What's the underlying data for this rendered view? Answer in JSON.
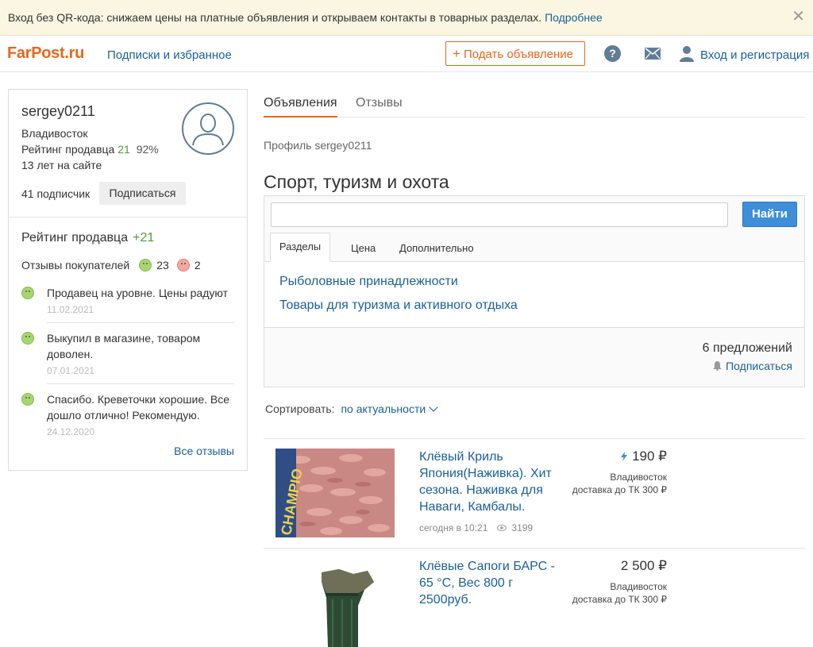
{
  "banner": {
    "text": "Вход без QR-кода: снижаем цены на платные объявления и открываем контакты в товарных разделах.",
    "more": "Подробнее",
    "close": "✕"
  },
  "header": {
    "logo_main": "FarPost",
    "logo_ru": ".ru",
    "subs": "Подписки и избранное",
    "post_plus": "+",
    "post": "Подать объявление",
    "help": "?",
    "login": "Вход и регистрация"
  },
  "profile": {
    "name": "sergey0211",
    "city": "Владивосток",
    "rating_label": "Рейтинг продавца",
    "rating_value": "21",
    "rating_pct": "92%",
    "years": "13 лет на сайте",
    "subscribers": "41 подписчик",
    "subscribe_btn": "Подписаться",
    "rating_title": "Рейтинг продавца",
    "rating_title_value": "+21",
    "reviews_label": "Отзывы покупателей",
    "good_count": "23",
    "bad_count": "2",
    "reviews": [
      {
        "text": "Продавец на уровне. Цены радуют",
        "date": "11.02.2021"
      },
      {
        "text": "Выкупил в магазине, товаром доволен.",
        "date": "07.01.2021"
      },
      {
        "text": "Спасибо. Креветочки хорошие. Все дошло отлично! Рекомендую.",
        "date": "24.12.2020"
      }
    ],
    "all_reviews": "Все отзывы"
  },
  "tabs": {
    "ads": "Объявления",
    "reviews": "Отзывы"
  },
  "crumb": "Профиль sergey0211",
  "category_title": "Спорт, туризм и охота",
  "search": {
    "value": "",
    "button": "Найти",
    "tabs": [
      "Разделы",
      "Цена",
      "Дополнительно"
    ],
    "sections": [
      "Рыболовные принадлежности",
      "Товары для туризма и активного отдыха"
    ],
    "offers": "6 предложений",
    "subscribe": "Подписаться"
  },
  "sort": {
    "label": "Сортировать:",
    "value": "по актуальности"
  },
  "items": [
    {
      "title": "Клёвый Криль Япония(Наживка). Хит сезона. Наживка для Наваги, Камбалы.",
      "date": "сегодня в 10:21",
      "views": "3199",
      "price": "190 ₽",
      "city": "Владивосток",
      "delivery": "доставка до ТК 300 ₽",
      "thumb_text": "CHAMPIO"
    },
    {
      "title": "Клёвые Сапоги БАРС - 65 °C, Вес 800 г 2500руб.",
      "price": "2 500 ₽",
      "city": "Владивосток",
      "delivery": "доставка до ТК 300 ₽"
    }
  ],
  "colors": {
    "accent": "#e8671b",
    "link": "#1a5f99",
    "positive": "#4d9a35",
    "search_button": "#3e8ed9",
    "banner_bg": "#faf6e1"
  }
}
